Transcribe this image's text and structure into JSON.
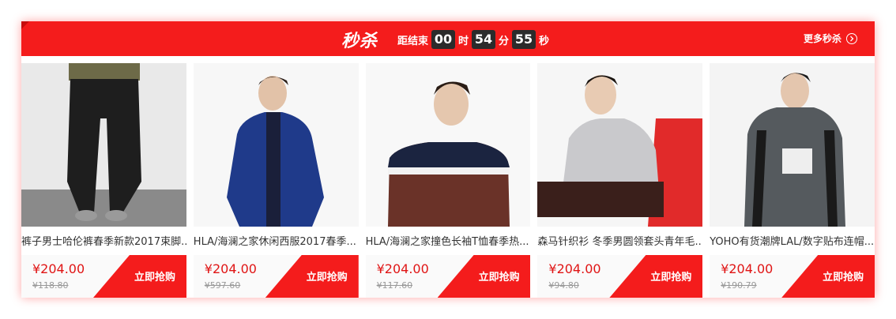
{
  "header": {
    "logo_text": "秒杀",
    "countdown_label": "距结束",
    "hours": "00",
    "hours_unit": "时",
    "minutes": "54",
    "minutes_unit": "分",
    "seconds": "55",
    "seconds_unit": "秒",
    "more_label": "更多秒杀"
  },
  "products": [
    {
      "title": "裤子男士哈伦裤春季新款2017束脚...",
      "price": "¥204.00",
      "original_price": "¥118.80",
      "buy_label": "立即抢购"
    },
    {
      "title": "HLA/海澜之家休闲西服2017春季...",
      "price": "¥204.00",
      "original_price": "¥597.60",
      "buy_label": "立即抢购"
    },
    {
      "title": "HLA/海澜之家撞色长袖T恤春季热...",
      "price": "¥204.00",
      "original_price": "¥117.60",
      "buy_label": "立即抢购"
    },
    {
      "title": "森马针织衫 冬季男圆领套头青年毛...",
      "price": "¥204.00",
      "original_price": "¥94.80",
      "buy_label": "立即抢购"
    },
    {
      "title": "YOHO有货潮牌LAL/数字贴布连帽...",
      "price": "¥204.00",
      "original_price": "¥190.79",
      "buy_label": "立即抢购"
    }
  ],
  "colors": {
    "accent": "#f41c1c",
    "timer_bg": "#2b2b2b",
    "price": "#e01515"
  }
}
